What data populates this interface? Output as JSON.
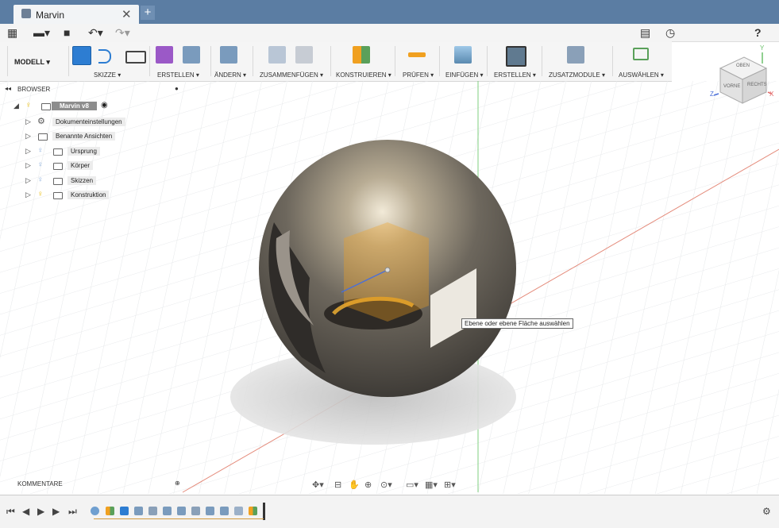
{
  "window": {
    "tab_title": "Marvin",
    "tab_close": "✕",
    "new_tab": "+"
  },
  "quickbar": {
    "grid_icon": "grid-icon",
    "file_icon": "file-icon",
    "save_icon": "save-icon",
    "undo_icon": "undo-icon",
    "redo_icon": "redo-icon",
    "help_label": "?"
  },
  "ribbon": {
    "workspace": "MODELL ▾",
    "groups": [
      {
        "label": "SKIZZE ▾"
      },
      {
        "label": "ERSTELLEN ▾"
      },
      {
        "label": "ÄNDERN ▾"
      },
      {
        "label": "ZUSAMMENFÜGEN ▾"
      },
      {
        "label": "KONSTRUIEREN ▾"
      },
      {
        "label": "PRÜFEN ▾"
      },
      {
        "label": "EINFÜGEN ▾"
      },
      {
        "label": "ERSTELLEN ▾"
      },
      {
        "label": "ZUSATZMODULE ▾"
      },
      {
        "label": "AUSWÄHLEN ▾"
      }
    ]
  },
  "browser": {
    "title": "BROWSER",
    "root": "Marvin v8",
    "items": [
      {
        "label": "Dokumenteinstellungen"
      },
      {
        "label": "Benannte Ansichten"
      },
      {
        "label": "Ursprung"
      },
      {
        "label": "Körper"
      },
      {
        "label": "Skizzen"
      },
      {
        "label": "Konstruktion"
      }
    ]
  },
  "viewcube": {
    "top": "OBEN",
    "front": "VORNE",
    "right": "RECHTS",
    "axis_x": "X",
    "axis_y": "Y",
    "axis_z": "Z"
  },
  "tooltip": "Ebene oder ebene Fläche auswählen",
  "comments": {
    "title": "KOMMENTARE"
  },
  "colors": {
    "titlebar": "#5b7da3",
    "accent": "#2d7dd2",
    "sphere": "#6a655c",
    "plane": "#f0a020"
  }
}
